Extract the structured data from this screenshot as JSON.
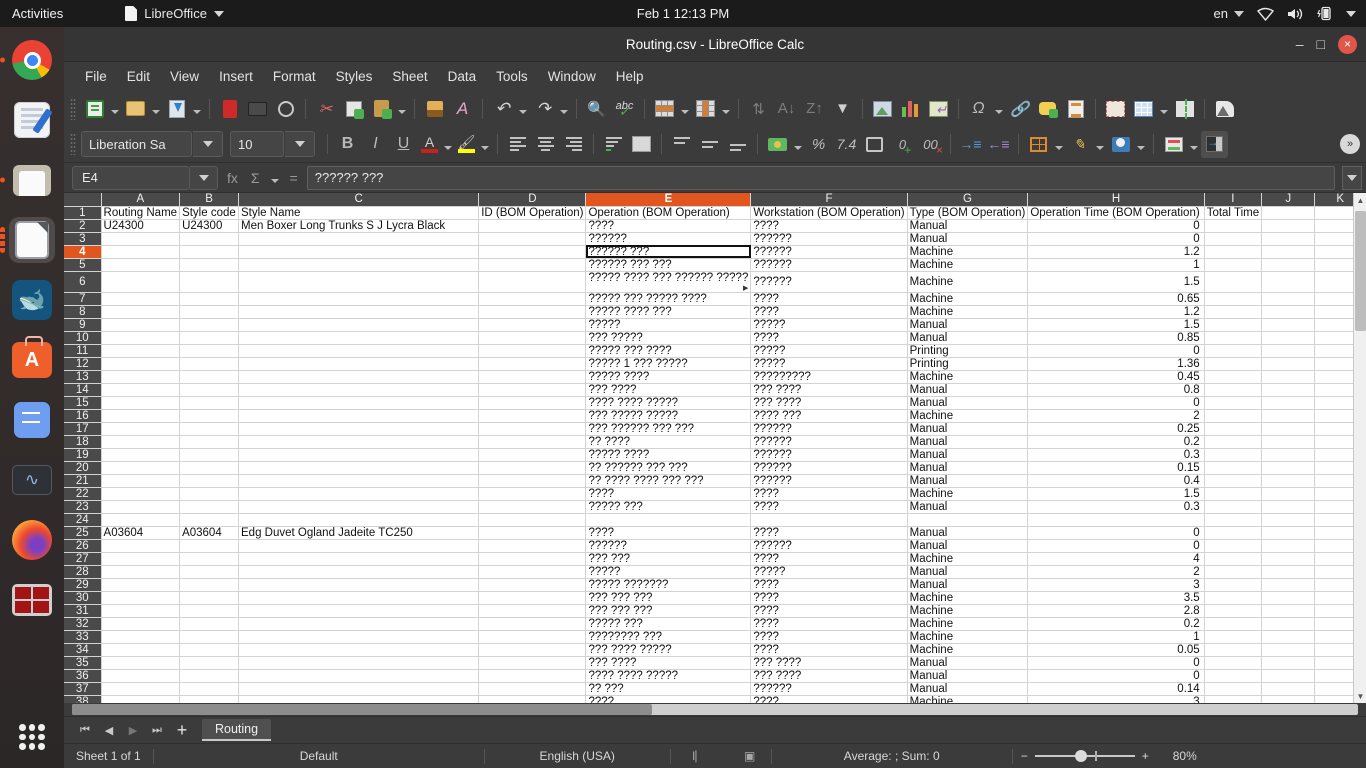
{
  "gnome": {
    "activities": "Activities",
    "app_name": "LibreOffice",
    "clock": "Feb 1  12:13 PM",
    "language": "en"
  },
  "dock": {
    "items": [
      {
        "name": "google-chrome",
        "running": true
      },
      {
        "name": "text-editor",
        "running": false
      },
      {
        "name": "files",
        "running": true
      },
      {
        "name": "libreoffice",
        "running": true,
        "active": true
      },
      {
        "name": "mysql-workbench",
        "running": false
      },
      {
        "name": "app-store",
        "running": false
      },
      {
        "name": "todo-app",
        "running": false
      },
      {
        "name": "system-monitor",
        "running": false
      },
      {
        "name": "firefox",
        "running": false
      },
      {
        "name": "remote-desktop",
        "running": false
      }
    ]
  },
  "window": {
    "title": "Routing.csv - LibreOffice Calc",
    "minimize": "–",
    "maximize": "□",
    "close": "×"
  },
  "menubar": [
    "File",
    "Edit",
    "View",
    "Insert",
    "Format",
    "Styles",
    "Sheet",
    "Data",
    "Tools",
    "Window",
    "Help"
  ],
  "toolbar_standard": [
    "new-document",
    "open-document",
    "save-document",
    "export-pdf",
    "print",
    "print-preview",
    "cut",
    "copy",
    "paste",
    "clone-formatting",
    "clear-formatting",
    "undo",
    "redo",
    "find-replace",
    "spelling-check",
    "row-tools",
    "column-tools",
    "sort-ascending",
    "sort-descending",
    "sort",
    "autofilter",
    "insert-image",
    "insert-chart",
    "pivot-table",
    "special-character",
    "insert-hyperlink",
    "insert-comment",
    "headers-footers",
    "freeze-rows-columns",
    "define-print-area",
    "split-window",
    "show-draw-functions"
  ],
  "toolbar_formatting": {
    "font_name": "Liberation Sa",
    "font_size": "10",
    "buttons": [
      "bold",
      "italic",
      "underline",
      "font-color",
      "highlight-color",
      "align-left",
      "align-center",
      "align-right",
      "wrap-text",
      "merge-cells",
      "align-top",
      "align-middle",
      "align-bottom",
      "format-currency",
      "format-percent",
      "format-number",
      "format-date",
      "add-decimal",
      "delete-decimal",
      "increase-indent",
      "decrease-indent",
      "borders",
      "border-style",
      "background-color",
      "cell-styles",
      "sidebar-settings"
    ]
  },
  "formula_bar": {
    "name_box": "E4",
    "function_wizard": "fx",
    "sum": "Σ",
    "formula_icon": "=",
    "input_line": "?????? ???"
  },
  "sheet": {
    "columns": [
      "A",
      "B",
      "C",
      "D",
      "E",
      "F",
      "G",
      "H",
      "I",
      "J",
      "K"
    ],
    "selected_column": "E",
    "selected_row": 4,
    "selected_cell": "E4",
    "widths": [
      74,
      59,
      248,
      99,
      158,
      144,
      116,
      162,
      56,
      64,
      60
    ],
    "headers": [
      "Routing Name",
      "Style code",
      "Style Name",
      "ID (BOM Operation)",
      "Operation (BOM Operation)",
      "Workstation (BOM Operation)",
      "Type (BOM Operation)",
      "Operation Time  (BOM Operation)",
      "Total Time",
      "",
      ""
    ],
    "rows": [
      {
        "n": 1,
        "cells": [
          "Routing Name",
          "Style code",
          "Style Name",
          "ID (BOM Operation)",
          "Operation (BOM Operation)",
          "Workstation (BOM Operation)",
          "Type (BOM Operation)",
          "Operation Time  (BOM Operation)",
          "Total Time",
          "",
          ""
        ],
        "header": true
      },
      {
        "n": 2,
        "cells": [
          "U24300",
          "U24300",
          "Men Boxer Long Trunks  S J Lycra Black",
          "",
          "????",
          "????",
          "Manual",
          "0",
          "",
          "",
          ""
        ]
      },
      {
        "n": 3,
        "cells": [
          "",
          "",
          "",
          "",
          "??????",
          "??????",
          "Manual",
          "0",
          "",
          "",
          ""
        ]
      },
      {
        "n": 4,
        "cells": [
          "",
          "",
          "",
          "",
          "?????? ???",
          "??????",
          "Machine",
          "1.2",
          "",
          "",
          ""
        ]
      },
      {
        "n": 5,
        "cells": [
          "",
          "",
          "",
          "",
          "?????? ??? ???",
          "??????",
          "Machine",
          "1",
          "",
          "",
          ""
        ]
      },
      {
        "n": 6,
        "cells": [
          "",
          "",
          "",
          "",
          "????? ???? ??? ?????? ?????",
          "??????",
          "Machine",
          "1.5",
          "",
          "",
          ""
        ],
        "overflow": 4
      },
      {
        "n": 7,
        "cells": [
          "",
          "",
          "",
          "",
          "????? ??? ????? ????",
          "????",
          "Machine",
          "0.65",
          "",
          "",
          ""
        ]
      },
      {
        "n": 8,
        "cells": [
          "",
          "",
          "",
          "",
          "????? ???? ???",
          "????",
          "Machine",
          "1.2",
          "",
          "",
          ""
        ]
      },
      {
        "n": 9,
        "cells": [
          "",
          "",
          "",
          "",
          "?????",
          "?????",
          "Manual",
          "1.5",
          "",
          "",
          ""
        ]
      },
      {
        "n": 10,
        "cells": [
          "",
          "",
          "",
          "",
          "??? ?????",
          "????",
          "Manual",
          "0.85",
          "",
          "",
          ""
        ]
      },
      {
        "n": 11,
        "cells": [
          "",
          "",
          "",
          "",
          "????? ??? ????",
          "?????",
          "Printing",
          "0",
          "",
          "",
          ""
        ]
      },
      {
        "n": 12,
        "cells": [
          "",
          "",
          "",
          "",
          "????? 1 ??? ?????",
          "?????",
          "Printing",
          "1.36",
          "",
          "",
          ""
        ]
      },
      {
        "n": 13,
        "cells": [
          "",
          "",
          "",
          "",
          "????? ????",
          "?????????",
          "Machine",
          "0.45",
          "",
          "",
          ""
        ]
      },
      {
        "n": 14,
        "cells": [
          "",
          "",
          "",
          "",
          "??? ????",
          "??? ????",
          "Manual",
          "0.8",
          "",
          "",
          ""
        ]
      },
      {
        "n": 15,
        "cells": [
          "",
          "",
          "",
          "",
          "???? ???? ?????",
          "??? ????",
          "Manual",
          "0",
          "",
          "",
          ""
        ]
      },
      {
        "n": 16,
        "cells": [
          "",
          "",
          "",
          "",
          "??? ????? ?????",
          "???? ???",
          "Machine",
          "2",
          "",
          "",
          ""
        ]
      },
      {
        "n": 17,
        "cells": [
          "",
          "",
          "",
          "",
          "??? ?????? ??? ???",
          "??????",
          "Manual",
          "0.25",
          "",
          "",
          ""
        ]
      },
      {
        "n": 18,
        "cells": [
          "",
          "",
          "",
          "",
          "?? ????",
          "??????",
          "Manual",
          "0.2",
          "",
          "",
          ""
        ]
      },
      {
        "n": 19,
        "cells": [
          "",
          "",
          "",
          "",
          "????? ????",
          "??????",
          "Manual",
          "0.3",
          "",
          "",
          ""
        ]
      },
      {
        "n": 20,
        "cells": [
          "",
          "",
          "",
          "",
          "?? ?????? ??? ???",
          "??????",
          "Manual",
          "0.15",
          "",
          "",
          ""
        ]
      },
      {
        "n": 21,
        "cells": [
          "",
          "",
          "",
          "",
          "?? ???? ???? ??? ???",
          "??????",
          "Manual",
          "0.4",
          "",
          "",
          ""
        ]
      },
      {
        "n": 22,
        "cells": [
          "",
          "",
          "",
          "",
          "????",
          "????",
          "Machine",
          "1.5",
          "",
          "",
          ""
        ]
      },
      {
        "n": 23,
        "cells": [
          "",
          "",
          "",
          "",
          "????? ???",
          "????",
          "Manual",
          "0.3",
          "",
          "",
          ""
        ]
      },
      {
        "n": 24,
        "cells": [
          "",
          "",
          "",
          "",
          "",
          "",
          "",
          "",
          "",
          "",
          ""
        ]
      },
      {
        "n": 25,
        "cells": [
          "A03604",
          "A03604",
          "Edg Duvet  Ogland Jadeite  TC250",
          "",
          "????",
          "????",
          "Manual",
          "0",
          "",
          "",
          ""
        ]
      },
      {
        "n": 26,
        "cells": [
          "",
          "",
          "",
          "",
          "??????",
          "??????",
          "Manual",
          "0",
          "",
          "",
          ""
        ]
      },
      {
        "n": 27,
        "cells": [
          "",
          "",
          "",
          "",
          "??? ???",
          "????",
          "Machine",
          "4",
          "",
          "",
          ""
        ]
      },
      {
        "n": 28,
        "cells": [
          "",
          "",
          "",
          "",
          "?????",
          "?????",
          "Manual",
          "2",
          "",
          "",
          ""
        ]
      },
      {
        "n": 29,
        "cells": [
          "",
          "",
          "",
          "",
          "????? ???????",
          "????",
          "Manual",
          "3",
          "",
          "",
          ""
        ]
      },
      {
        "n": 30,
        "cells": [
          "",
          "",
          "",
          "",
          "??? ??? ???",
          "????",
          "Machine",
          "3.5",
          "",
          "",
          ""
        ]
      },
      {
        "n": 31,
        "cells": [
          "",
          "",
          "",
          "",
          "??? ??? ???",
          "????",
          "Machine",
          "2.8",
          "",
          "",
          ""
        ]
      },
      {
        "n": 32,
        "cells": [
          "",
          "",
          "",
          "",
          "????? ???",
          "????",
          "Machine",
          "0.2",
          "",
          "",
          ""
        ]
      },
      {
        "n": 33,
        "cells": [
          "",
          "",
          "",
          "",
          "???????? ???",
          "????",
          "Machine",
          "1",
          "",
          "",
          ""
        ]
      },
      {
        "n": 34,
        "cells": [
          "",
          "",
          "",
          "",
          "??? ???? ?????",
          "????",
          "Machine",
          "0.05",
          "",
          "",
          ""
        ]
      },
      {
        "n": 35,
        "cells": [
          "",
          "",
          "",
          "",
          "??? ????",
          "??? ????",
          "Manual",
          "0",
          "",
          "",
          ""
        ]
      },
      {
        "n": 36,
        "cells": [
          "",
          "",
          "",
          "",
          "???? ???? ?????",
          "??? ????",
          "Manual",
          "0",
          "",
          "",
          ""
        ]
      },
      {
        "n": 37,
        "cells": [
          "",
          "",
          "",
          "",
          "?? ???",
          "??????",
          "Manual",
          "0.14",
          "",
          "",
          ""
        ]
      },
      {
        "n": 38,
        "cells": [
          "",
          "",
          "",
          "",
          "????",
          "????",
          "Machine",
          "3",
          "",
          "",
          ""
        ]
      }
    ]
  },
  "sheet_tabs": {
    "first": "⏮",
    "prev": "◀",
    "next": "▶",
    "last": "⏭",
    "add": "+",
    "tabs": [
      "Routing"
    ]
  },
  "statusbar": {
    "sheet_count": "Sheet 1 of 1",
    "page_style": "Default",
    "language": "English (USA)",
    "insert_mode": "",
    "selection_mode": "",
    "average_sum": "Average: ; Sum: 0",
    "zoom_out": "−",
    "zoom_in": "+",
    "zoom_level": "80%"
  },
  "colors": {
    "accent": "#e0561e",
    "titlebar": "#353535",
    "toolbar": "#3b3b3b",
    "grid_bg": "#ffffff",
    "close_button": "#e2564a"
  }
}
